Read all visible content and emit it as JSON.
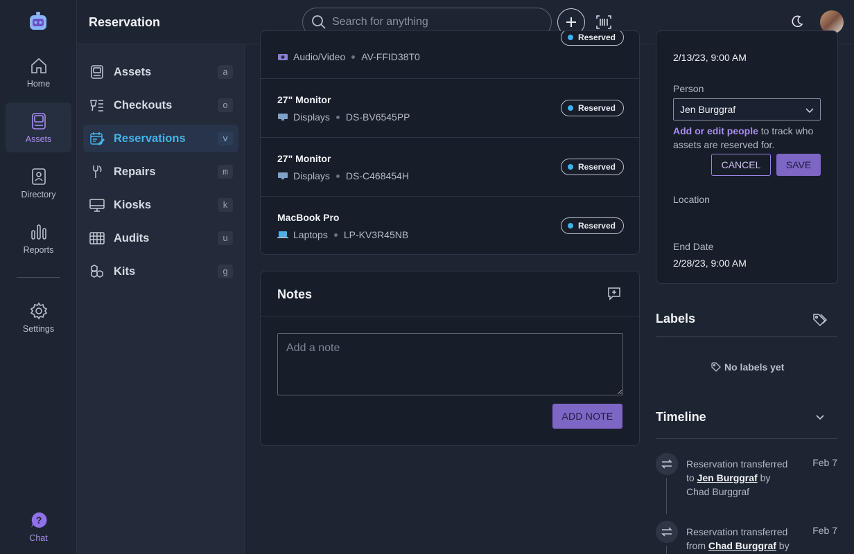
{
  "app": {
    "page_title": "Reservation"
  },
  "colors": {
    "accent": "#a98cf0",
    "active_blue": "#45b3e8",
    "reserved_dot": "#3fb1ee",
    "primary_button": "#7d66c4"
  },
  "search": {
    "placeholder": "Search for anything"
  },
  "rail": {
    "items": [
      {
        "label": "Home",
        "icon": "home-icon"
      },
      {
        "label": "Assets",
        "icon": "asset-icon"
      },
      {
        "label": "Directory",
        "icon": "directory-icon"
      },
      {
        "label": "Reports",
        "icon": "reports-icon"
      },
      {
        "label": "Settings",
        "icon": "gear-icon"
      }
    ],
    "chat": "Chat"
  },
  "subnav": {
    "items": [
      {
        "label": "Assets",
        "key": "a"
      },
      {
        "label": "Checkouts",
        "key": "o"
      },
      {
        "label": "Reservations",
        "key": "v"
      },
      {
        "label": "Repairs",
        "key": "m"
      },
      {
        "label": "Kiosks",
        "key": "k"
      },
      {
        "label": "Audits",
        "key": "u"
      },
      {
        "label": "Kits",
        "key": "g"
      }
    ]
  },
  "assets": [
    {
      "name": "",
      "category": "Audio/Video",
      "tag": "AV-FFID38T0",
      "status": "Reserved"
    },
    {
      "name": "27\" Monitor",
      "category": "Displays",
      "tag": "DS-BV6545PP",
      "status": "Reserved"
    },
    {
      "name": "27\" Monitor",
      "category": "Displays",
      "tag": "DS-C468454H",
      "status": "Reserved"
    },
    {
      "name": "MacBook Pro",
      "category": "Laptops",
      "tag": "LP-KV3R45NB",
      "status": "Reserved"
    }
  ],
  "notes": {
    "title": "Notes",
    "placeholder": "Add a note",
    "add_label": "ADD NOTE"
  },
  "reservation": {
    "start_date": "2/13/23, 9:00 AM",
    "person_label": "Person",
    "person_value": "Jen Burggraf",
    "help_link": "Add or edit people",
    "help_text": " to track who assets are reserved for.",
    "cancel_label": "CANCEL",
    "save_label": "SAVE",
    "location_label": "Location",
    "end_label": "End Date",
    "end_date": "2/28/23, 9:00 AM"
  },
  "labels": {
    "title": "Labels",
    "empty": "No labels yet"
  },
  "timeline": {
    "title": "Timeline",
    "events": [
      {
        "pre": "Reservation transferred to ",
        "who": "Jen Burggraf",
        "mid": " by Chad Burggraf",
        "date": "Feb 7"
      },
      {
        "pre": "Reservation transferred from ",
        "who": "Chad Burggraf",
        "mid": " by",
        "date": "Feb 7"
      }
    ]
  }
}
